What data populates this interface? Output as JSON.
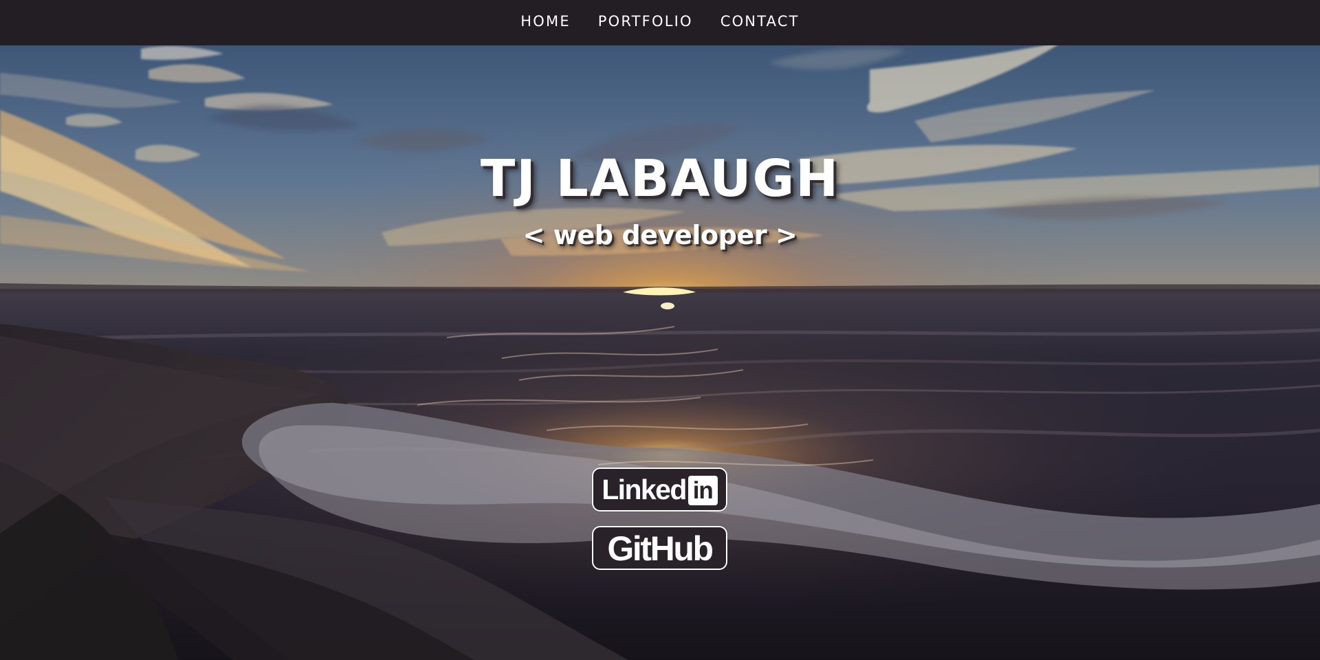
{
  "nav": {
    "items": [
      {
        "label": "HOME"
      },
      {
        "label": "PORTFOLIO"
      },
      {
        "label": "CONTACT"
      }
    ]
  },
  "hero": {
    "title": "TJ LABAUGH",
    "subtitle": "< web developer >",
    "background": "sunset-over-ocean-image"
  },
  "social": {
    "linkedin": {
      "text": "Linked",
      "mark": "in"
    },
    "github": {
      "text": "GitHub"
    }
  },
  "colors": {
    "nav_background": "#231d24",
    "text": "#ffffff",
    "button_background": "#292329",
    "button_border": "#ffffff"
  },
  "icons": {
    "linkedin": "linkedin-icon",
    "github": "github-icon"
  }
}
